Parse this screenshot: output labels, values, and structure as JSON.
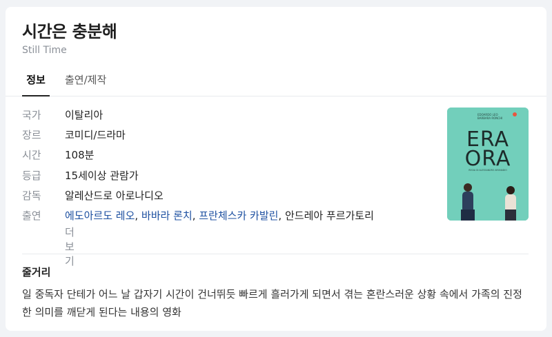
{
  "header": {
    "title": "시간은 충분해",
    "subtitle": "Still Time"
  },
  "tabs": [
    {
      "label": "정보",
      "active": true
    },
    {
      "label": "출연/제작",
      "active": false
    }
  ],
  "info": {
    "country": {
      "label": "국가",
      "value": "이탈리아"
    },
    "genre": {
      "label": "장르",
      "value": "코미디/드라마"
    },
    "runtime": {
      "label": "시간",
      "value": "108분"
    },
    "rating": {
      "label": "등급",
      "value": "15세이상 관람가"
    },
    "director": {
      "label": "감독",
      "value": "알레산드로 아로나디오"
    },
    "cast": {
      "label": "출연",
      "names": [
        "에도아르도 레오",
        "바바라 론치",
        "프란체스카 카발린",
        "안드레아 푸르가토리"
      ],
      "more": "더보기"
    }
  },
  "poster": {
    "title_line1": "ERA",
    "title_line2": "ORA",
    "top_text": "EDOARDO LEO",
    "top_text2": "BARBARA RONCHI",
    "credit": "REGIA DI ALESSANDRO ARONADIO"
  },
  "plot": {
    "title": "줄거리",
    "text": "일 중독자 단테가 어느 날 갑자기 시간이 건너뛰듯 빠르게 흘러가게 되면서 겪는 혼란스러운 상황 속에서 가족의 진정한 의미를 깨닫게 된다는 내용의 영화"
  },
  "colors": {
    "link": "#1c4fa0",
    "label": "#8a8f97",
    "poster_bg": "#6fcbb7"
  }
}
